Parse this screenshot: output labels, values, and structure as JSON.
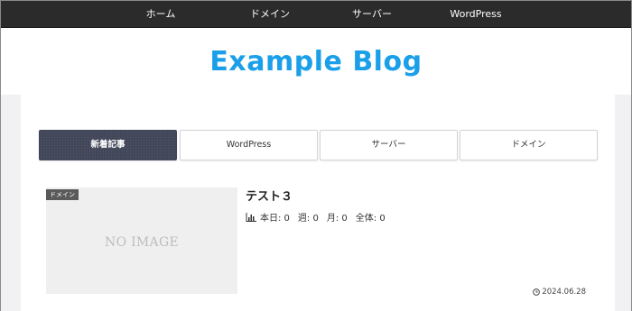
{
  "nav": {
    "items": [
      {
        "label": "ホーム"
      },
      {
        "label": "ドメイン"
      },
      {
        "label": "サーバー"
      },
      {
        "label": "WordPress"
      }
    ]
  },
  "site": {
    "title": "Example Blog",
    "title_color": "#1a9fe8"
  },
  "tabs": [
    {
      "label": "新着記事",
      "active": true
    },
    {
      "label": "WordPress",
      "active": false
    },
    {
      "label": "サーバー",
      "active": false
    },
    {
      "label": "ドメイン",
      "active": false
    }
  ],
  "post": {
    "category": "ドメイン",
    "thumbnail_text": "NO IMAGE",
    "title": "テスト３",
    "stats": {
      "icon": "bar-chart-icon",
      "today": "本日: 0",
      "week": "週: 0",
      "month": "月: 0",
      "total": "全体: 0"
    },
    "date_icon": "clock-icon",
    "date": "2024.06.28"
  },
  "colors": {
    "nav_bg": "#2b2b2b",
    "active_tab_bg": "#404558",
    "accent": "#1a9fe8"
  }
}
